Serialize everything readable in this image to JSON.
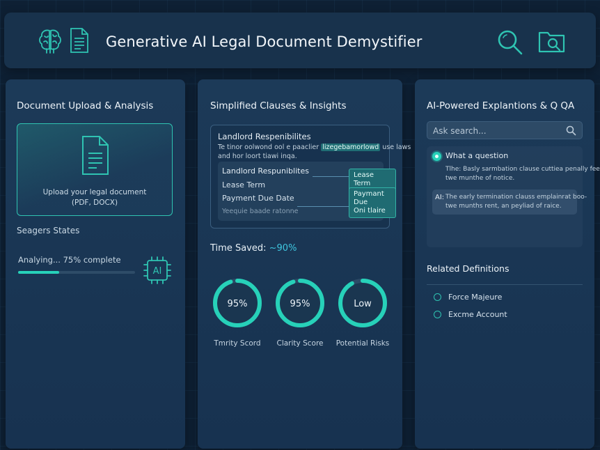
{
  "header": {
    "title": "Generative AI Legal Document Demystifier",
    "icons": [
      "brain-icon",
      "document-icon",
      "search-icon",
      "folder-search-icon"
    ]
  },
  "upload_panel": {
    "title": "Document Upload & Analysis",
    "upload_line1": "Upload your legal document",
    "upload_line2": "(PDF, DOCX)",
    "states_label": "Seagers States",
    "progress_text": "Analying... 75% complete",
    "progress_fraction": 0.35,
    "chip_label": "AI"
  },
  "clauses_panel": {
    "title": "Simplified Clauses & Insights",
    "card_heading": "Landlord Respenibilites",
    "card_line1_pre": "Te tinor oolwond ool e paaclier",
    "card_line1_hl": "lizegebamorlowd",
    "card_line1_post": "use laws",
    "card_line2": "and hor loort tiawi inqa.",
    "items": [
      "Landlord Respuniblites",
      "Lease Term",
      "Payment Due Date",
      "Yeequie baade ratonne"
    ],
    "tag_lease_term": "Lease Term",
    "tag_payment_line1": "Paymant Due",
    "tag_payment_line2": "Oni tlaire",
    "time_saved_label": "Time Saved:",
    "time_saved_value": "~90%",
    "gauges": [
      {
        "value": "95%",
        "label": "Tmrity Scord",
        "fraction": 0.95
      },
      {
        "value": "95%",
        "label": "Clarity Score",
        "fraction": 0.95
      },
      {
        "value": "Low",
        "label": "Potential Risks",
        "fraction": 0.92
      }
    ]
  },
  "qa_panel": {
    "title": "AI-Powered Explantions & Q QA",
    "search_placeholder": "Ask search...",
    "question": "What a question",
    "question_answer_line1": "Tlhe: Basly sarmbation clause cuttiea penally fee",
    "question_answer_line2": "twe munthe of notice.",
    "ai_prefix": "AI:",
    "ai_answer_line1": "The early termination clauss emplainrat boo-",
    "ai_answer_line2": "twe munths rent, an peyliad of raice.",
    "definitions_title": "Related Definitions",
    "definitions": [
      "Force Majeure",
      "Excme Account"
    ]
  },
  "colors": {
    "accent": "#27d1b9",
    "panel": "#1c3a58",
    "background": "#0e2034",
    "time_saved_value": "#3fc7e0"
  }
}
